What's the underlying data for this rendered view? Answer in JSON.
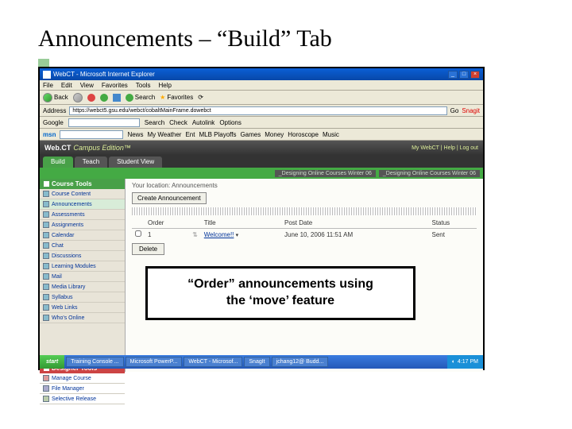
{
  "slide": {
    "title": "Announcements – “Build” Tab"
  },
  "browser": {
    "window_title": "WebCT - Microsoft Internet Explorer",
    "menus": [
      "File",
      "Edit",
      "View",
      "Favorites",
      "Tools",
      "Help"
    ],
    "nav": {
      "back": "Back",
      "search": "Search",
      "favorites": "Favorites"
    },
    "address_label": "Address",
    "address_value": "https://webct5.gsu.edu/webct/cobaltMainFrame.dowebct",
    "go": "Go",
    "snagit": "Snagit"
  },
  "google": {
    "label": "Google",
    "search": "Search",
    "check": "Check",
    "autolink": "Autolink",
    "options": "Options"
  },
  "msn": {
    "label": "msn",
    "news": "News",
    "statesboro": "My Weather",
    "sports": "Ent",
    "mlb": "MLB Playoffs",
    "games": "Games",
    "money": "Money",
    "horoscope": "Horoscope",
    "music": "Music"
  },
  "webct": {
    "brand": "Web.CT",
    "edition": "Campus Edition™",
    "links": "My WebCT | Help | Log out",
    "tabs": {
      "build": "Build",
      "teach": "Teach",
      "student": "Student View"
    },
    "courses": [
      "_Designing Online Courses Winter 06",
      "_Designing Online Courses Winter 06"
    ]
  },
  "sidebar": {
    "tools_header": "Course Tools",
    "items": [
      "Course Content",
      "Announcements",
      "Assessments",
      "Assignments",
      "Calendar",
      "Chat",
      "Discussions",
      "Learning Modules",
      "Mail",
      "Media Library",
      "Syllabus",
      "Web Links",
      "Who's Online"
    ],
    "designer_header": "Designer Tools",
    "designer_items": [
      "Manage Course",
      "File Manager",
      "Selective Release"
    ]
  },
  "main": {
    "breadcrumb": "Your location: Announcements",
    "create_label": "Create Announcement",
    "columns": {
      "order": "Order",
      "title": "Title",
      "post_date": "Post Date",
      "status": "Status"
    },
    "row": {
      "order": "1",
      "title": "Welcome!!",
      "post_date": "June 10, 2006 11:51 AM",
      "status": "Sent"
    },
    "delete": "Delete"
  },
  "callout": {
    "line1": "“Order” announcements using",
    "line2": "the ‘move’ feature"
  },
  "taskbar": {
    "start": "start",
    "items": [
      "Training Console ...",
      "Microsoft PowerP...",
      "WebCT - Microsof...",
      "SnagIt",
      "jchang12@ Budd..."
    ],
    "time": "4:17 PM"
  }
}
